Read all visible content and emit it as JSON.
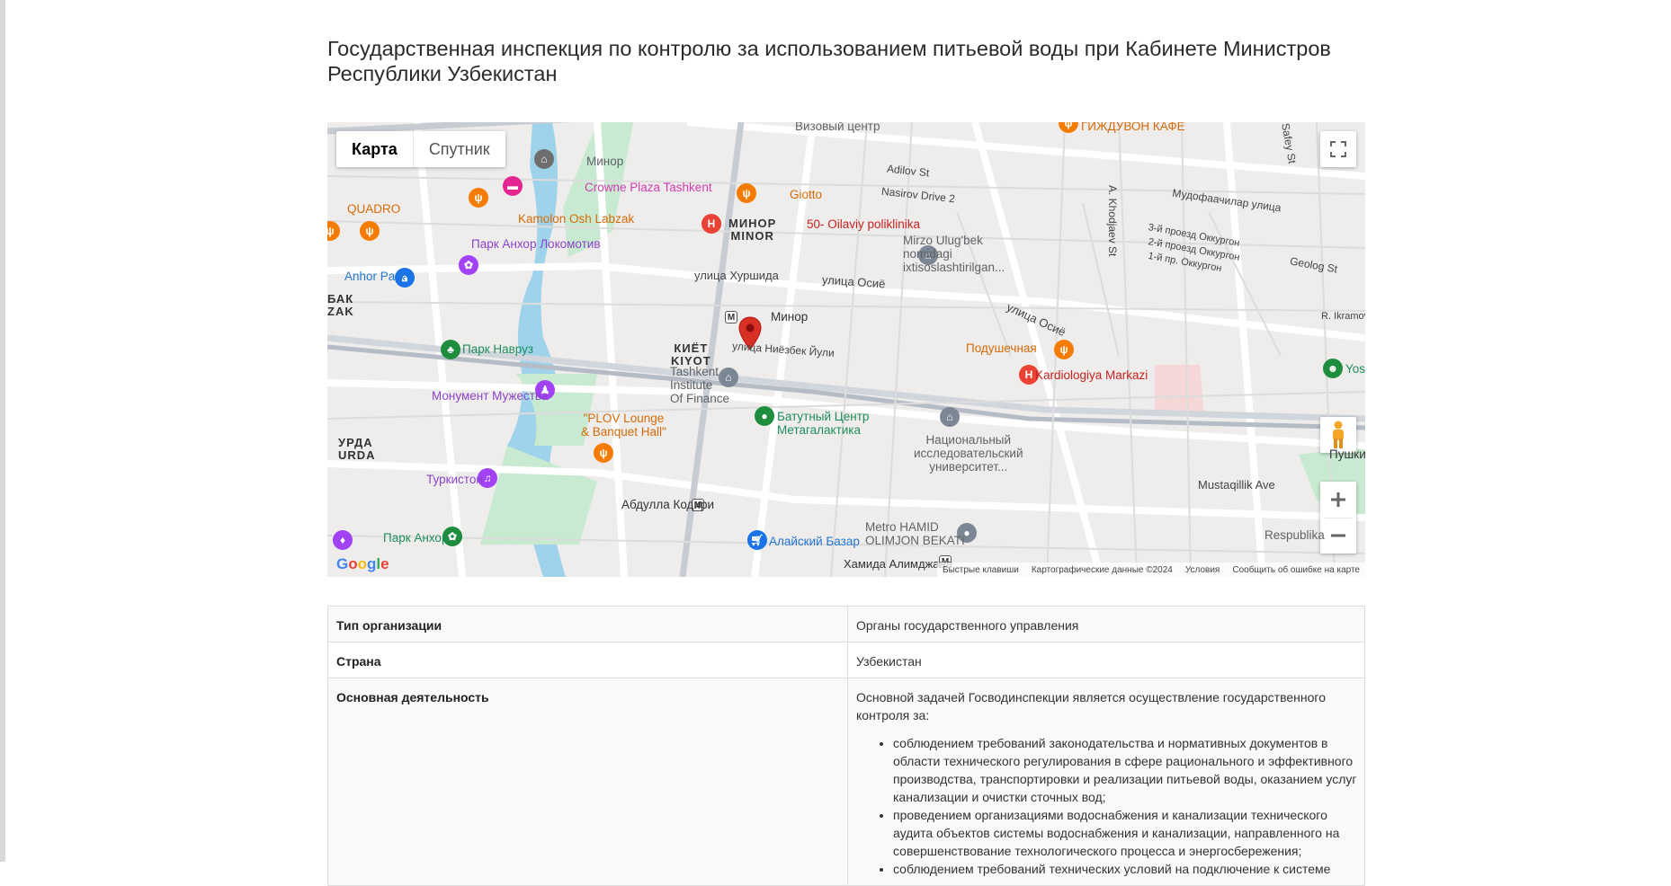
{
  "page": {
    "title": "Государственная инспекция по контролю за использованием питьевой воды при Кабинете Министров Республики Узбекистан"
  },
  "map": {
    "tabs": [
      "Карта",
      "Спутник"
    ],
    "active_tab": "Карта",
    "marker_color": "#d93025",
    "labels": {
      "vizovy": "Визовый центр",
      "gijduvon": "ГИЖДУВОН КАФЕ",
      "minor_poi": "Минор",
      "crowne": "Crowne Plaza Tashkent",
      "quadro": "QUADRO",
      "kamolon": "Kamolon Osh Labzak",
      "giotto": "Giotto",
      "adilov": "Adilov St",
      "nasirov": "Nasirov Drive 2",
      "minor_district": "МИНОР\nMINOR",
      "poliklinika": "50- Oilaviy poliklinika",
      "khodjaev": "A. Khodjaev St",
      "safey": "Safey St",
      "mudofaa": "Мудофаачилар улица",
      "park_lokomotiv": "Парк Анхор Локомотив",
      "mirzo": "Mirzo Ulug'bek nomidagi ixtisoslashtirilgan...",
      "proezd3": "3-й проезд Оккургон",
      "proezd2": "2-й проезд Оккургон",
      "proezd1": "1-й пр. Оккургон",
      "geolog": "Geolog St",
      "anhor_park": "Anhor Park",
      "khurshida": "улица Хуршида",
      "osie1": "улица Осиё",
      "osie2": "улица Осиё",
      "bak": "БАК\nZAK",
      "minor_metro": "Минор",
      "ikramov": "R. Ikramov",
      "navruz": "Парк Навруз",
      "niyozbek": "улица Ниёзбек Йули",
      "podushechnaya": "Подушечная",
      "kiyot": "КИЁТ\nKIYOT",
      "tif": "Tashkent\nInstitute\nOf Finance",
      "kardio": "Kardiologiya Markazi",
      "yoshlik": "Yoshlik",
      "monument": "Монумент Мужества",
      "plov": "\"PLOV Lounge\n& Banquet Hall\"",
      "batut": "Батутный Центр\nМетагалактика",
      "urda": "УРДА\nURDA",
      "nuu": "Национальный\nисследовательский\nуниверситет...",
      "pushkin": "Пушкин",
      "turkiston": "Туркистон",
      "mustaqillik": "Mustaqillik Ave",
      "abdulla": "Абдулла Кодири",
      "hamid": "Metro HAMID\nOLIMJON BEKATI",
      "park_anhor": "Парк Анхор",
      "alay": "Алайский Базар",
      "respublika": "Respublika",
      "hamida": "Хамида Алимджана"
    },
    "attribution": [
      "Быстрые клавиши",
      "Картографические данные ©2024",
      "Условия",
      "Сообщить об ошибке на карте"
    ],
    "logo": "Google"
  },
  "table": {
    "rows": [
      {
        "key": "Тип организации",
        "value": "Органы государственного управления"
      },
      {
        "key": "Страна",
        "value": "Узбекистан"
      },
      {
        "key": "Основная деятельность",
        "intro": "Основной задачей Госводинспекции является осуществление государственного контроля за:",
        "bullets": [
          "соблюдением требований законодательства и нормативных документов в области технического регулирования в сфере рационального и эффективного производства, транспортировки и реализации питьевой воды, оказанием услуг канализации и очистки сточных вод;",
          "проведением организациями водоснабжения и канализации технического аудита объектов системы водоснабжения и канализации, направленного на совершенствование технологического процесса и энергосбережения;",
          "соблюдением требований технических условий на подключение к системе"
        ]
      }
    ]
  }
}
